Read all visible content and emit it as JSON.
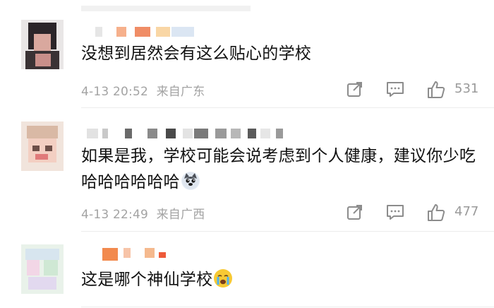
{
  "comments": [
    {
      "text": "没想到居然会有这么贴心的学校",
      "date": "4-13 20:52",
      "location": "来自广东",
      "likes": "531"
    },
    {
      "text": "如果是我，学校可能会说考虑到个人健康，建议你少吃哈哈哈哈哈哈",
      "emoji": "husky-face",
      "date": "4-13 22:49",
      "location": "来自广西",
      "likes": "477"
    },
    {
      "text": "这是哪个神仙学校",
      "emoji": "crying-face"
    }
  ],
  "icons": {
    "share": "share-icon",
    "reply": "comment-icon",
    "like": "thumbs-up-icon"
  },
  "colors": {
    "text": "#111111",
    "meta": "#a3a3a3",
    "icon": "#8c8c8c"
  }
}
